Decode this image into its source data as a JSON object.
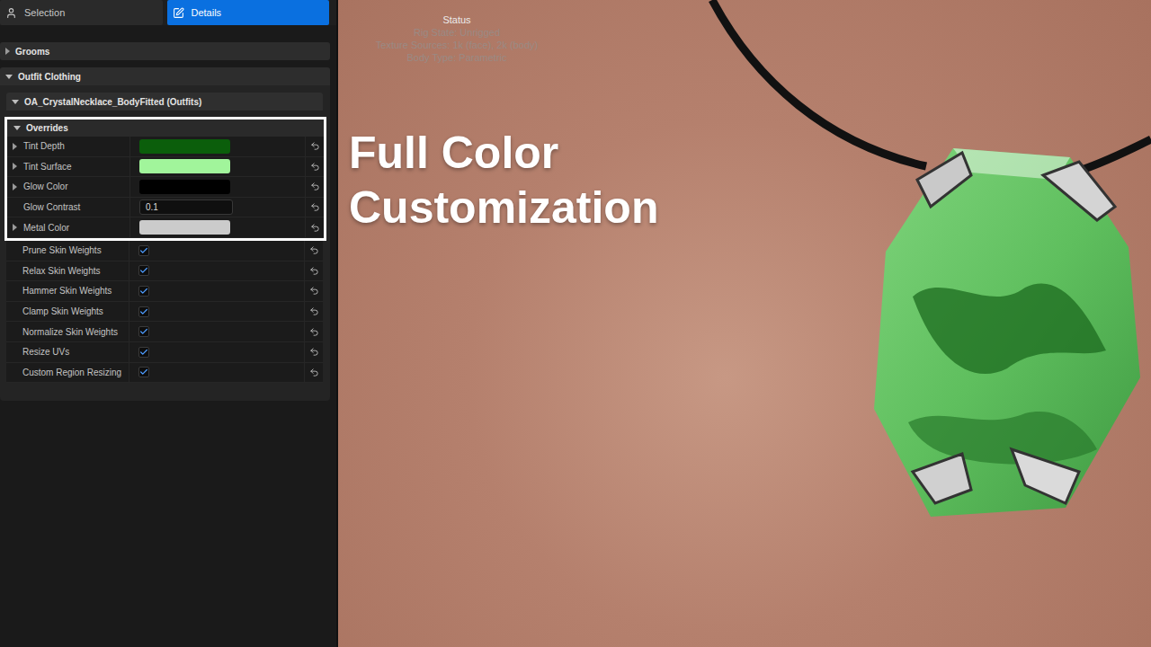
{
  "tabs": [
    {
      "label": "Selection",
      "selected": false
    },
    {
      "label": "Details",
      "selected": true
    }
  ],
  "sections": [
    {
      "label": "Grooms",
      "expanded": false
    },
    {
      "label": "Outfit Clothing",
      "expanded": true
    }
  ],
  "outfit": {
    "label": "OA_CrystalNecklace_BodyFitted (Outfits)",
    "expanded": true
  },
  "overrides": {
    "label": "Overrides",
    "expanded": true,
    "highlighted": true,
    "rows": [
      {
        "label": "Tint Depth",
        "kind": "color",
        "expandable": true,
        "expanded": false,
        "color": "#0b5e0b"
      },
      {
        "label": "Tint Surface",
        "kind": "color",
        "expandable": true,
        "expanded": false,
        "color": "#a1f59b"
      },
      {
        "label": "Glow Color",
        "kind": "color",
        "expandable": true,
        "expanded": false,
        "color": "#000000"
      },
      {
        "label": "Glow Contrast",
        "kind": "number",
        "expandable": false,
        "expanded": false,
        "value": "0.1"
      },
      {
        "label": "Metal Color",
        "kind": "color",
        "expandable": true,
        "expanded": false,
        "color": "#cbcbcb"
      }
    ]
  },
  "options": [
    {
      "label": "Prune Skin Weights",
      "checked": true
    },
    {
      "label": "Relax Skin Weights",
      "checked": true
    },
    {
      "label": "Hammer Skin Weights",
      "checked": true
    },
    {
      "label": "Clamp Skin Weights",
      "checked": true
    },
    {
      "label": "Normalize Skin Weights",
      "checked": true
    },
    {
      "label": "Resize UVs",
      "checked": true
    },
    {
      "label": "Custom Region Resizing",
      "checked": true
    }
  ],
  "viewport": {
    "status": {
      "title": "Status",
      "lines": [
        "Rig State: Unrigged",
        "Texture Sources: 1k (face), 2k (body)",
        "Body Type: Parametric"
      ]
    },
    "caption": [
      "Full Color",
      "Customization"
    ]
  }
}
